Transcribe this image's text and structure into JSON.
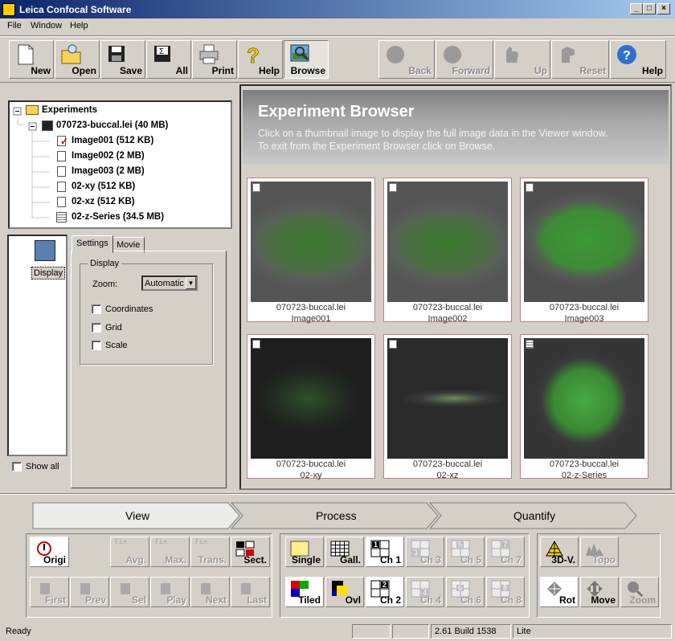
{
  "window": {
    "title": "Leica Confocal Software"
  },
  "menu": [
    "File",
    "Window",
    "Help"
  ],
  "toolbar": {
    "new": "New",
    "open": "Open",
    "save": "Save",
    "all": "All",
    "print": "Print",
    "help": "Help",
    "browse": "Browse",
    "back": "Back",
    "forward": "Forward",
    "up": "Up",
    "reset": "Reset",
    "help2": "Help"
  },
  "tree": {
    "root": "Experiments",
    "file": "070723-buccal.lei (40 MB)",
    "items": [
      "Image001 (512 KB)",
      "Image002 (2 MB)",
      "Image003 (2 MB)",
      "02-xy (512 KB)",
      "02-xz (512 KB)",
      "02-z-Series (34.5 MB)"
    ]
  },
  "left": {
    "display": "Display",
    "show_all": "Show all"
  },
  "settings": {
    "tab_settings": "Settings",
    "tab_movie": "Movie",
    "group": "Display",
    "zoom_label": "Zoom:",
    "zoom_value": "Automatic",
    "coordinates": "Coordinates",
    "grid": "Grid",
    "scale": "Scale"
  },
  "browser": {
    "title": "Experiment Browser",
    "line1": "Click on a thumbnail image to display the full image data in the Viewer window.",
    "line2": "To exit from the Experiment Browser click on Browse.",
    "thumbs": [
      {
        "file": "070723-buccal.lei",
        "name": "Image001"
      },
      {
        "file": "070723-buccal.lei",
        "name": "Image002"
      },
      {
        "file": "070723-buccal.lei",
        "name": "Image003"
      },
      {
        "file": "070723-buccal.lei",
        "name": "02-xy"
      },
      {
        "file": "070723-buccal.lei",
        "name": "02-xz"
      },
      {
        "file": "070723-buccal.lei",
        "name": "02-z-Series"
      }
    ]
  },
  "workflow": {
    "view": "View",
    "process": "Process",
    "quantify": "Quantify"
  },
  "panel": {
    "origi": "Origi",
    "avg": "Avg.",
    "max": "Max.",
    "trans": "Trans.",
    "sect": "Sect.",
    "first": "First",
    "prev": "Prev",
    "sel": "Sel",
    "play": "Play",
    "next": "Next",
    "last": "Last",
    "fix": "fix",
    "single": "Single",
    "gall": "Gall.",
    "tiled": "Tiled",
    "ovl": "Ovl",
    "ch1": "Ch 1",
    "ch2": "Ch 2",
    "ch3": "Ch 3",
    "ch4": "Ch 4",
    "ch5": "Ch 5",
    "ch6": "Ch 6",
    "ch7": "Ch 7",
    "ch8": "Ch 8",
    "n1": "1",
    "n2": "2",
    "n3": "3",
    "n4": "4",
    "n5": "5",
    "n6": "6",
    "n7": "7",
    "n8": "8",
    "v3d": "3D-V.",
    "topo": "Topo",
    "rot": "Rot",
    "move": "Move",
    "zoom": "Zoom"
  },
  "status": {
    "ready": "Ready",
    "build": "2.61 Build 1538",
    "edition": "Lite"
  }
}
